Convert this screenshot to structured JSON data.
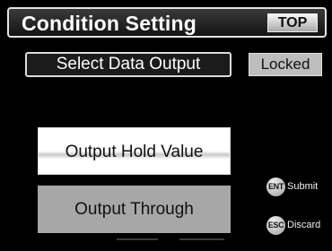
{
  "header": {
    "title": "Condition Setting",
    "top_button": "TOP"
  },
  "section": {
    "label": "Select Data Output",
    "status": "Locked"
  },
  "options": [
    {
      "label": "Output Hold Value",
      "selected": true
    },
    {
      "label": "Output Through",
      "selected": false
    }
  ],
  "hints": {
    "submit": {
      "key": "ENT",
      "label": "Submit"
    },
    "discard": {
      "key": "ESC",
      "label": "Discard"
    }
  },
  "colors": {
    "background": "#000000",
    "selected_option": "#ffffff",
    "unselected_option": "#a7a7a7",
    "badge": "#bdbdbd"
  }
}
